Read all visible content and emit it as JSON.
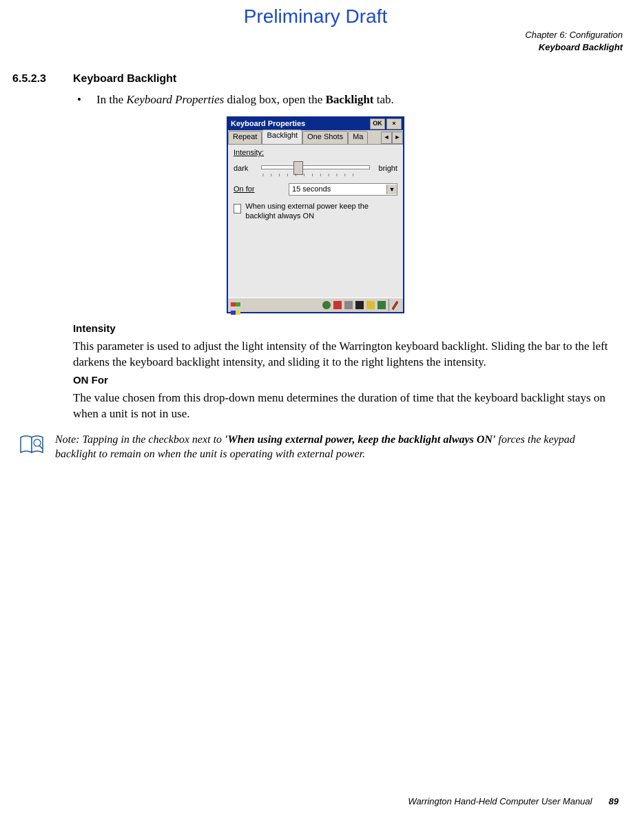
{
  "draft_header": "Preliminary Draft",
  "chapter": {
    "line1": "Chapter 6: Configuration",
    "line2": "Keyboard Backlight"
  },
  "section": {
    "number": "6.5.2.3",
    "title": "Keyboard Backlight"
  },
  "bullet": {
    "pre": "In the ",
    "ital": "Keyboard Properties",
    "mid": " dialog box, open the ",
    "bold": "Backlight",
    "post": " tab."
  },
  "dialog": {
    "title": "Keyboard Properties",
    "ok": "OK",
    "close": "×",
    "tabs": [
      "Repeat",
      "Backlight",
      "One Shots",
      "Ma"
    ],
    "tab_scroll_left": "◄",
    "tab_scroll_right": "►",
    "intensity_label": "Intensity:",
    "slider_left": "dark",
    "slider_right": "bright",
    "onfor_label": "On for",
    "onfor_value": "15 seconds",
    "dropdown_arrow": "▼",
    "checkbox_text": "When using external power keep the backlight always ON"
  },
  "intensity": {
    "heading": "Intensity",
    "body": "This parameter is used to adjust the light intensity of the Warrington keyboard backlight. Sliding the bar to the left darkens the keyboard backlight intensity, and sliding it to the right lightens the intensity."
  },
  "onfor": {
    "heading": "ON For",
    "body": "The value chosen from this drop-down menu determines the duration of time that the keyboard backlight stays on when a unit is not in use."
  },
  "note": {
    "lead": "Note: Tapping in the checkbox next to ",
    "bold": "'When using external power, keep the backlight always ON'",
    "rest": " forces the keypad backlight to remain on when the unit is operating with external power."
  },
  "footer": {
    "text": "Warrington Hand-Held Computer User Manual",
    "page": "89"
  }
}
